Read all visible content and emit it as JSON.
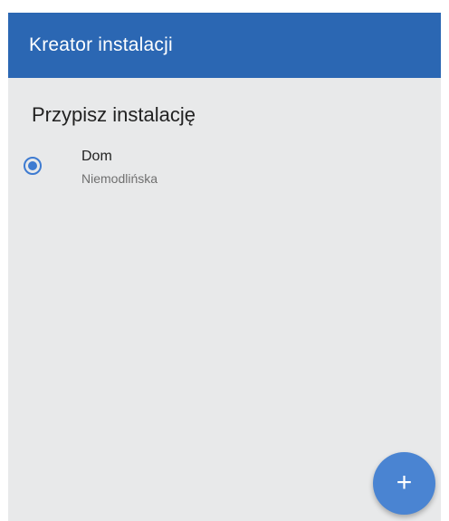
{
  "appbar": {
    "title": "Kreator instalacji",
    "color": "#2b67b3"
  },
  "section": {
    "title": "Przypisz instalację"
  },
  "installations": [
    {
      "name": "Dom",
      "address": "Niemodlińska",
      "selected": true
    }
  ],
  "fab": {
    "icon": "plus-icon",
    "glyph": "+",
    "color": "#4a84d2"
  }
}
